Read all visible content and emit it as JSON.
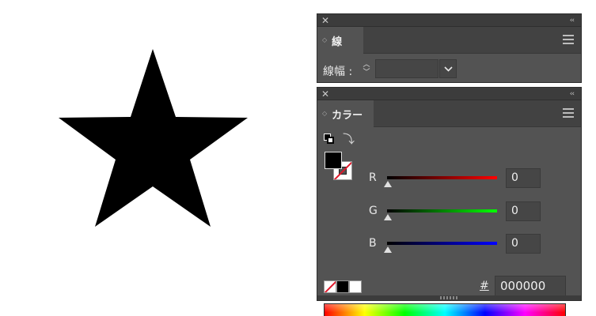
{
  "canvas": {
    "shape_fill": "#000000",
    "shape_icon": "star-shape"
  },
  "stroke_panel": {
    "tab_label": "線",
    "width_label": "線幅 :",
    "width_value": "",
    "stepper_up": "︿",
    "stepper_down": "﹀",
    "dropdown_icon": "chevron-down-icon"
  },
  "color_panel": {
    "tab_label": "カラー",
    "sliders": [
      {
        "label": "R",
        "value": "0",
        "color": "#ff0000"
      },
      {
        "label": "G",
        "value": "0",
        "color": "#00ff00"
      },
      {
        "label": "B",
        "value": "0",
        "color": "#0000ff"
      }
    ],
    "hex_label": "#",
    "hex_value": "000000",
    "fill_color": "#000000",
    "stroke_color": "none"
  },
  "chrome": {
    "close_glyph": "✕",
    "collapse_glyph": "‹‹",
    "grip_glyph": "◇"
  }
}
